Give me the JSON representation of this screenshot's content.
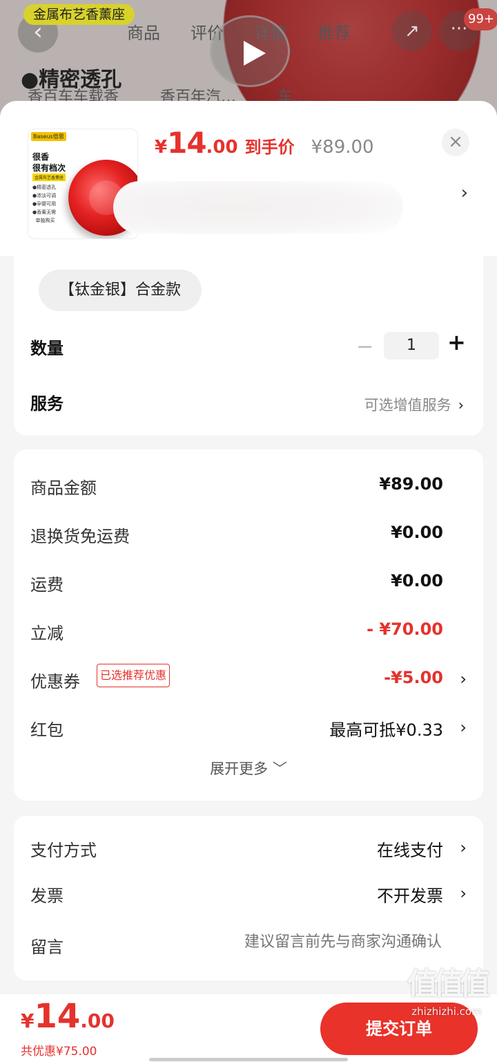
{
  "background_page": {
    "tag": "金属布艺香薰座",
    "tabs": [
      "商品",
      "评价",
      "详情",
      "推荐"
    ],
    "badge": "99+",
    "feature": "●精密透孔",
    "chips": [
      "香百车车载香",
      "香百年汽…",
      "车…"
    ]
  },
  "sheet": {
    "thumbnail": {
      "brand": "Baseus倍思",
      "headline": "很香\n很有档次",
      "subline": "金属布艺香薰座",
      "bullets": [
        "●精密透孔",
        "●浓淡可调",
        "●孕婴可用",
        "●香薰无需",
        "  单独购买"
      ]
    },
    "price": {
      "currency": "¥",
      "integer": "14",
      "decimal": ".00",
      "tag": "到手价",
      "original": "¥89.00"
    },
    "close_label": "×",
    "address_chevron": "›",
    "variant": "【钛金银】合金款",
    "quantity": {
      "label": "数量",
      "minus": "−",
      "value": "1",
      "plus": "+"
    },
    "service": {
      "label": "服务",
      "value": "可选增值服务",
      "chevron": "›"
    }
  },
  "fees": [
    {
      "label": "商品金额",
      "value": "¥89.00"
    },
    {
      "label": "退换货免运费",
      "value": "¥0.00"
    },
    {
      "label": "运费",
      "value": "¥0.00"
    },
    {
      "label": "立减",
      "value": "- ¥70.00"
    },
    {
      "label": "优惠券",
      "badge": "已选推荐优惠",
      "value": "-¥5.00",
      "chevron": "›"
    },
    {
      "label": "红包",
      "value": "最高可抵¥0.33",
      "chevron": "›"
    }
  ],
  "expand_more": "展开更多 ﹀",
  "payment": {
    "method_label": "支付方式",
    "method_value": "在线支付",
    "invoice_label": "发票",
    "invoice_value": "不开发票",
    "memo_label": "留言",
    "memo_placeholder": "建议留言前先与商家沟通确认",
    "chevron": "›"
  },
  "bottom": {
    "currency": "¥",
    "integer": "14",
    "decimal": ".00",
    "saved": "共优惠¥75.00",
    "submit": "提交订单"
  },
  "watermark": {
    "logo": "值值值",
    "url": "zhizhizhi.com"
  },
  "colors": {
    "accent": "#e5322d",
    "submit": "#e8322a",
    "overlay": "#b9b2b0"
  }
}
